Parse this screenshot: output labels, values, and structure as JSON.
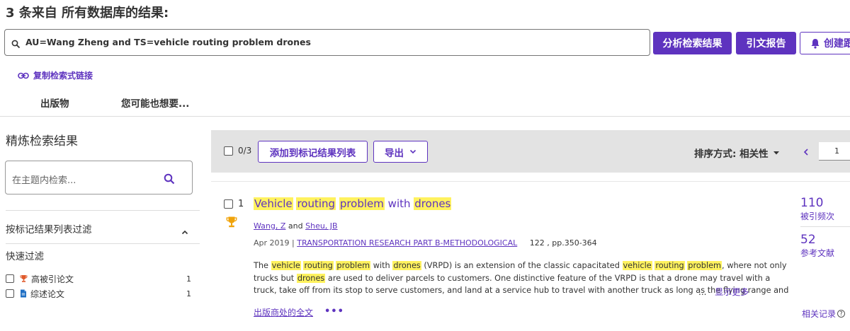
{
  "header": {
    "results_title": "3 条来自 所有数据库的结果:",
    "query": "AU=Wang Zheng and TS=vehicle routing problem drones",
    "analyze_label": "分析检索结果",
    "citation_label": "引文报告",
    "alert_label": "创建跟",
    "copy_link_label": "复制检索式链接"
  },
  "tabs": [
    "出版物",
    "您可能也想要..."
  ],
  "sidebar": {
    "title": "精炼检索结果",
    "search_placeholder": "在主题内检索...",
    "marked_filter": "按标记结果列表过滤",
    "quick_filter": "快速过滤",
    "quick_items": [
      {
        "label": "高被引论文",
        "count": "1",
        "icon": "trophy-icon"
      },
      {
        "label": "综述论文",
        "count": "1",
        "icon": "document-icon"
      }
    ]
  },
  "toolbar": {
    "selected": "0/3",
    "add_marked_label": "添加到标记结果列表",
    "export_label": "导出",
    "sort_label": "排序方式: 相关性",
    "page": "1"
  },
  "result": {
    "index": "1",
    "title_parts": [
      {
        "t": "Vehicle",
        "h": true
      },
      {
        "t": " ",
        "h": false
      },
      {
        "t": "routing",
        "h": true
      },
      {
        "t": " ",
        "h": false
      },
      {
        "t": "problem",
        "h": true
      },
      {
        "t": " with ",
        "h": false
      },
      {
        "t": "drones",
        "h": true
      }
    ],
    "author1": "Wang, Z",
    "and": "and",
    "author2": "Sheu, JB",
    "date": "Apr 2019",
    "journal": "TRANSPORTATION RESEARCH PART B-METHODOLOGICAL",
    "volume_pages": "122 , pp.350-364",
    "abstract_parts": [
      {
        "t": "The ",
        "h": false
      },
      {
        "t": "vehicle",
        "h": true
      },
      {
        "t": " ",
        "h": false
      },
      {
        "t": "routing",
        "h": true
      },
      {
        "t": " ",
        "h": false
      },
      {
        "t": "problem",
        "h": true
      },
      {
        "t": " with ",
        "h": false
      },
      {
        "t": "drones",
        "h": true
      },
      {
        "t": " (VRPD) is an extension of the classic capacitated ",
        "h": false
      },
      {
        "t": "vehicle",
        "h": true
      },
      {
        "t": " ",
        "h": false
      },
      {
        "t": "routing",
        "h": true
      },
      {
        "t": " ",
        "h": false
      },
      {
        "t": "problem",
        "h": true
      },
      {
        "t": ", where not only trucks but ",
        "h": false
      },
      {
        "t": "drones",
        "h": true
      },
      {
        "t": " are used to deliver parcels to customers. One distinctive feature of the VRPD is that a drone may travel with a truck, take off from its stop to serve customers, and land at a service hub to travel with another truck as long as the flying range and",
        "h": false
      }
    ],
    "show_more_dots": "...",
    "show_more": "显示更多",
    "fulltext": "出版商处的全文",
    "more_dots": "•••",
    "times_cited": "110",
    "times_cited_label": "被引频次",
    "references": "52",
    "references_label": "参考文献",
    "related_label": "相关记录",
    "related_help": "?"
  },
  "colors": {
    "accent": "#5e33bf",
    "highlight": "#fff25e",
    "toolbar_bg": "#e3e3e3"
  }
}
